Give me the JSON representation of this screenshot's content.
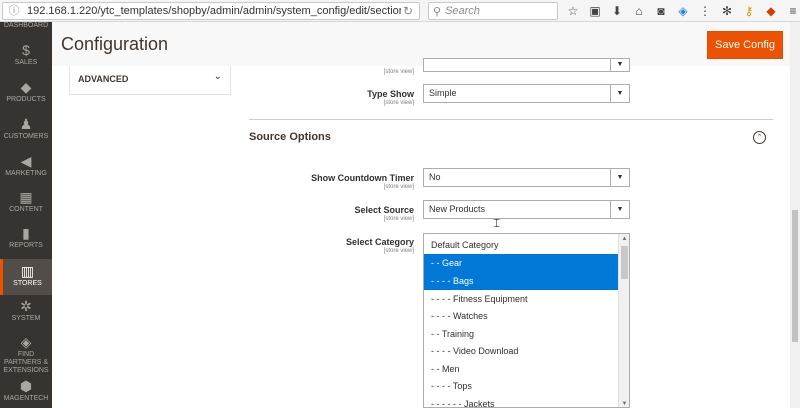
{
  "browser": {
    "url": "192.168.1.220/ytc_templates/shopby/admin/admin/system_config/edit/section/filterproducts/key/",
    "search_placeholder": "Search",
    "info_icon": "info-icon",
    "reload_icon": "reload-icon",
    "toolbar_icons": [
      "star-icon",
      "clipboard-icon",
      "download-icon",
      "home-icon",
      "pocket-icon",
      "extension-icon",
      "menu-dots-icon",
      "gear-icon",
      "key-icon",
      "addon-icon",
      "hamburger-icon"
    ]
  },
  "sidebar": {
    "items": [
      {
        "label": "DASHBOARD",
        "icon": "dashboard-icon",
        "glyph": ""
      },
      {
        "label": "SALES",
        "icon": "dollar-icon",
        "glyph": "$"
      },
      {
        "label": "PRODUCTS",
        "icon": "cube-icon",
        "glyph": "◆"
      },
      {
        "label": "CUSTOMERS",
        "icon": "person-icon",
        "glyph": "♟"
      },
      {
        "label": "MARKETING",
        "icon": "megaphone-icon",
        "glyph": "◀"
      },
      {
        "label": "CONTENT",
        "icon": "layout-icon",
        "glyph": "▦"
      },
      {
        "label": "REPORTS",
        "icon": "bar-chart-icon",
        "glyph": "▮"
      },
      {
        "label": "STORES",
        "icon": "storefront-icon",
        "glyph": "▥"
      },
      {
        "label": "SYSTEM",
        "icon": "gear-icon",
        "glyph": "✲"
      },
      {
        "label": "FIND PARTNERS & EXTENSIONS",
        "icon": "box-icon",
        "glyph": "◈"
      },
      {
        "label": "MAGENTECH",
        "icon": "hexagon-icon",
        "glyph": "⬢"
      }
    ],
    "active": "STORES"
  },
  "header": {
    "title": "Configuration",
    "save_label": "Save Config"
  },
  "left_panel": {
    "label": "ADVANCED",
    "chevron_icon": "chevron-down-icon"
  },
  "fields": {
    "top_scope": "[store view]",
    "type_show": {
      "label": "Type Show",
      "scope": "[store view]",
      "value": "Simple"
    },
    "countdown": {
      "label": "Show Countdown Timer",
      "scope": "[store view]",
      "value": "No"
    },
    "source": {
      "label": "Select Source",
      "scope": "[store view]",
      "value": "New Products"
    },
    "category": {
      "label": "Select Category",
      "scope": "[store view]"
    }
  },
  "section": {
    "title": "Source Options",
    "toggle_icon": "chevron-up-circle-icon"
  },
  "category_options": [
    {
      "label": "Default Category",
      "selected": false
    },
    {
      "label": "- - Gear",
      "selected": true
    },
    {
      "label": "- - - - Bags",
      "selected": true
    },
    {
      "label": "- - - - Fitness Equipment",
      "selected": false
    },
    {
      "label": "- - - - Watches",
      "selected": false
    },
    {
      "label": "- - Training",
      "selected": false
    },
    {
      "label": "- - - - Video Download",
      "selected": false
    },
    {
      "label": "- - Men",
      "selected": false
    },
    {
      "label": "- - - - Tops",
      "selected": false
    },
    {
      "label": "- - - - - - Jackets",
      "selected": false
    }
  ]
}
